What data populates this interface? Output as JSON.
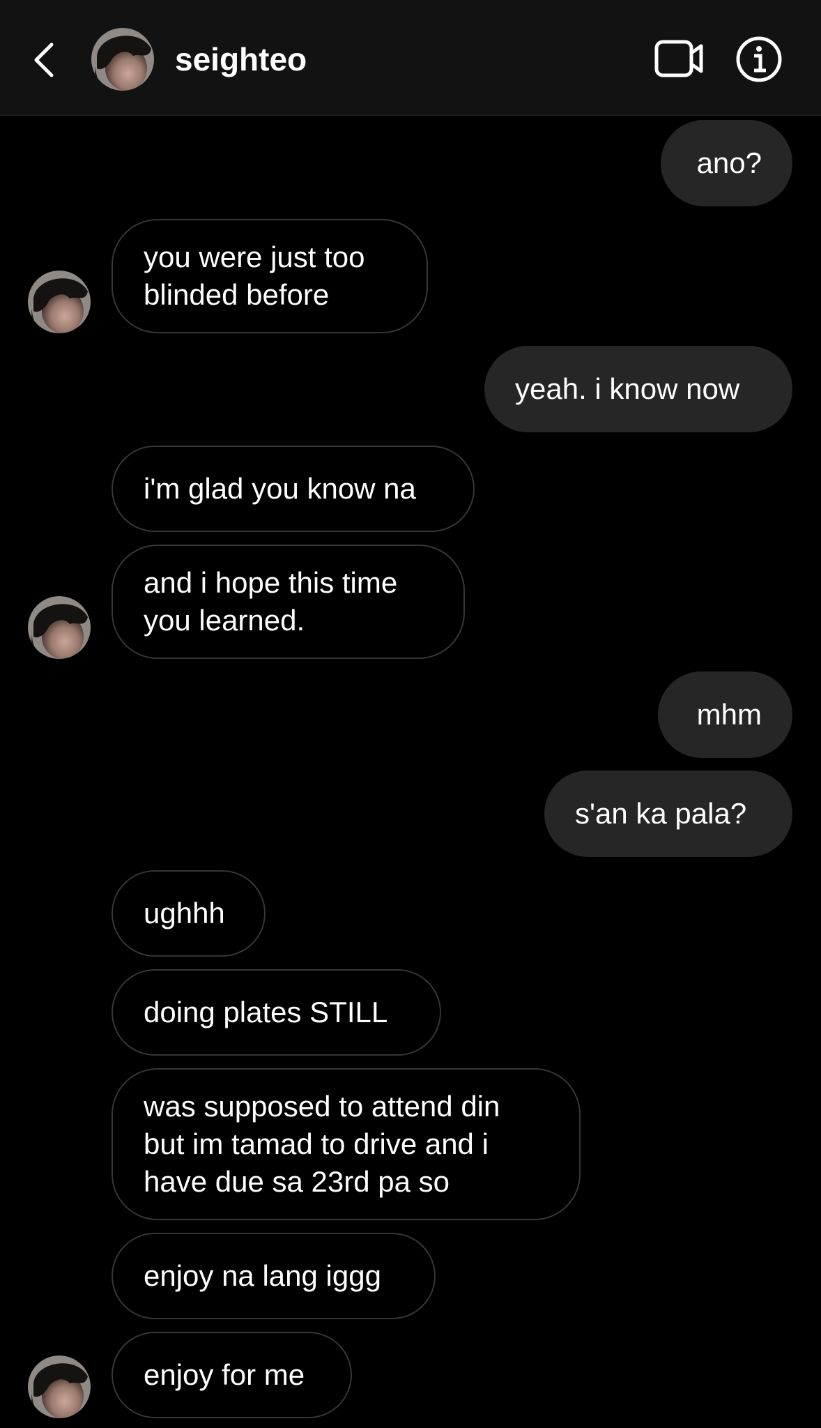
{
  "header": {
    "username": "seighteo"
  },
  "icons": {
    "back": "chevron-left-icon",
    "video": "video-camera-icon",
    "info": "info-icon"
  },
  "colors": {
    "background": "#000000",
    "header_background": "#121212",
    "outgoing_bubble": "#262626",
    "incoming_border": "#363636",
    "text": "#ffffff"
  },
  "messages": [
    {
      "direction": "outgoing",
      "text": "ano?"
    },
    {
      "direction": "incoming",
      "text": "you were just too\nblinded before",
      "avatar": true
    },
    {
      "direction": "outgoing",
      "text": "yeah. i know now"
    },
    {
      "direction": "incoming",
      "text": "i'm glad you know na"
    },
    {
      "direction": "incoming",
      "text": "and i hope this time\nyou learned.",
      "avatar": true
    },
    {
      "direction": "outgoing",
      "text": "mhm"
    },
    {
      "direction": "outgoing",
      "text": "s'an ka pala?"
    },
    {
      "direction": "incoming",
      "text": "ughhh"
    },
    {
      "direction": "incoming",
      "text": "doing plates STILL"
    },
    {
      "direction": "incoming",
      "text": "was supposed to attend din\nbut im tamad to drive and i\nhave due sa 23rd pa so"
    },
    {
      "direction": "incoming",
      "text": "enjoy na lang iggg"
    },
    {
      "direction": "incoming",
      "text": "enjoy for me",
      "avatar": true
    }
  ]
}
